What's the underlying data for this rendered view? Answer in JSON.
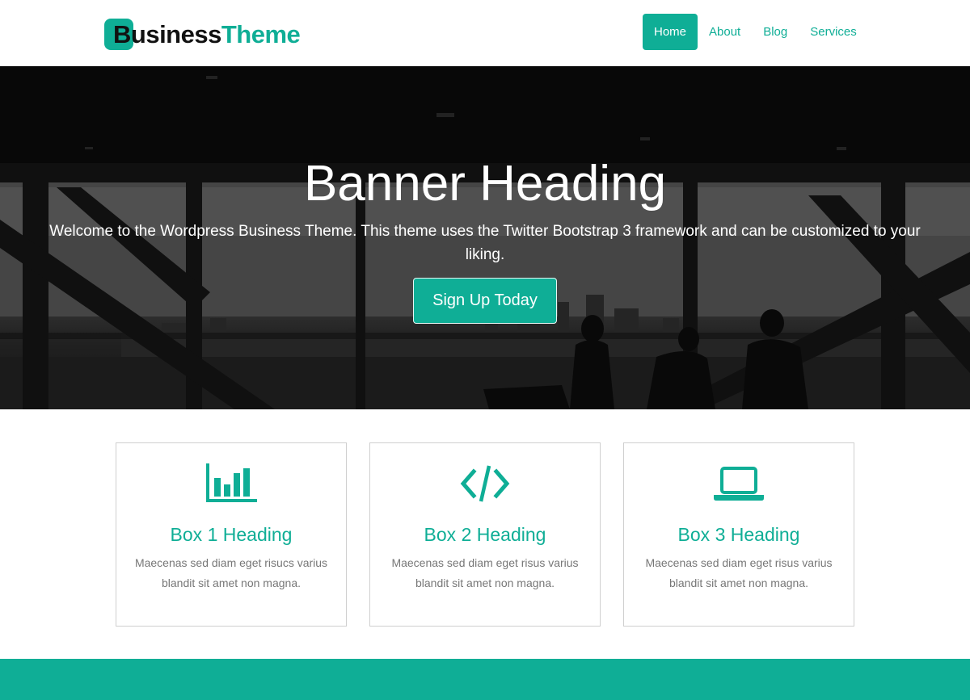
{
  "brand": {
    "part1": "Business",
    "part2": "Theme",
    "accent": "#0fae96"
  },
  "nav": [
    {
      "label": "Home",
      "active": true
    },
    {
      "label": "About",
      "active": false
    },
    {
      "label": "Blog",
      "active": false
    },
    {
      "label": "Services",
      "active": false
    }
  ],
  "banner": {
    "title": "Banner Heading",
    "text": "Welcome to the Wordpress Business Theme. This theme uses the Twitter Bootstrap 3 framework and can be customized to your liking.",
    "button_label": "Sign Up Today"
  },
  "boxes": [
    {
      "icon": "bar-chart-icon",
      "heading": "Box 1 Heading",
      "text": "Maecenas sed diam eget risucs varius blandit sit amet non magna."
    },
    {
      "icon": "code-icon",
      "heading": "Box 2 Heading",
      "text": "Maecenas sed diam eget risus varius blandit sit amet non magna."
    },
    {
      "icon": "laptop-icon",
      "heading": "Box 3 Heading",
      "text": "Maecenas sed diam eget risus varius blandit sit amet non magna."
    }
  ]
}
